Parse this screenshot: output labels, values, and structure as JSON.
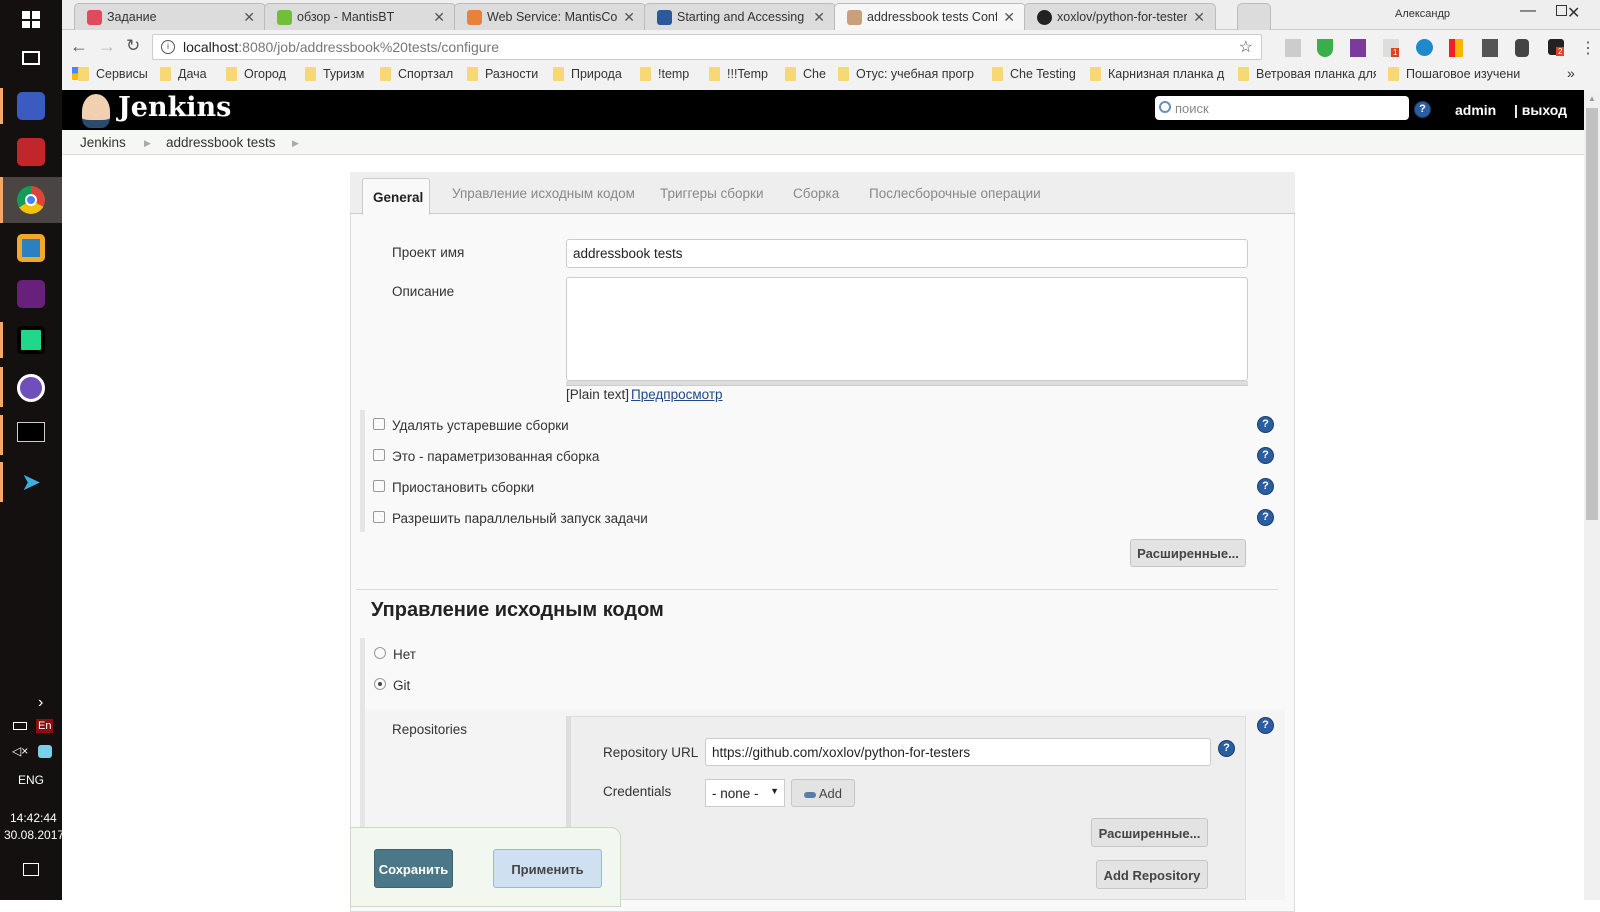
{
  "taskbar": {
    "icons": [
      "windows-start",
      "task-view",
      "floppy-app",
      "stack-app",
      "chrome",
      "vmware",
      "visual-studio",
      "pycharm",
      "github-desktop",
      "cmd",
      "kingfisher-app"
    ],
    "tray": {
      "lang_badge": "En",
      "lang": "ENG",
      "time": "14:42:44",
      "date": "30.08.2017"
    }
  },
  "browser": {
    "tabs": [
      {
        "title": "Задание",
        "color": "#e04a5f"
      },
      {
        "title": "обзор - MantisBT",
        "color": "#6fbf3a"
      },
      {
        "title": "Web Service: MantisConn",
        "color": "#e8823a"
      },
      {
        "title": "Starting and Accessing Je",
        "color": "#2a5a9a"
      },
      {
        "title": "addressbook tests Config",
        "color": "#c9a07a"
      },
      {
        "title": "xoxlov/python-for-tester",
        "color": "#222222"
      }
    ],
    "user": "Александр",
    "url_host": "localhost",
    "url_rest": ":8080/job/addressbook%20tests/configure",
    "bookmarks": [
      "Сервисы",
      "Дача",
      "Огород",
      "Туризм",
      "Спортзал",
      "Разности",
      "Природа",
      "!temp",
      "!!!Temp",
      "Che",
      "Отус: учебная прогр",
      "Che Testing",
      "Карнизная планка д",
      "Ветровая планка для",
      "Пошаговое изучени"
    ],
    "badges": [
      "1",
      "2"
    ]
  },
  "jenkins": {
    "logo": "Jenkins",
    "search_placeholder": "поиск",
    "user": "admin",
    "logout": "| выход",
    "breadcrumb": [
      "Jenkins",
      "addressbook tests"
    ],
    "tabs": [
      "General",
      "Управление исходным кодом",
      "Триггеры сборки",
      "Сборка",
      "Послесборочные операции"
    ],
    "general": {
      "name_label": "Проект имя",
      "name_value": "addressbook tests",
      "desc_label": "Описание",
      "plain_text": "[Plain text]",
      "preview": "Предпросмотр",
      "checkboxes": [
        "Удалять устаревшие сборки",
        "Это - параметризованная сборка",
        "Приостановить сборки",
        "Разрешить параллельный запуск задачи"
      ],
      "advanced": "Расширенные..."
    },
    "scm": {
      "heading": "Управление исходным кодом",
      "options": [
        "Нет",
        "Git"
      ],
      "selected": "Git",
      "repositories_label": "Repositories",
      "repo_url_label": "Repository URL",
      "repo_url": "https://github.com/xoxlov/python-for-testers",
      "credentials_label": "Credentials",
      "credentials_value": "- none -",
      "add": "Add",
      "advanced": "Расширенные...",
      "add_repository": "Add Repository"
    },
    "save": "Сохранить",
    "apply": "Применить"
  }
}
